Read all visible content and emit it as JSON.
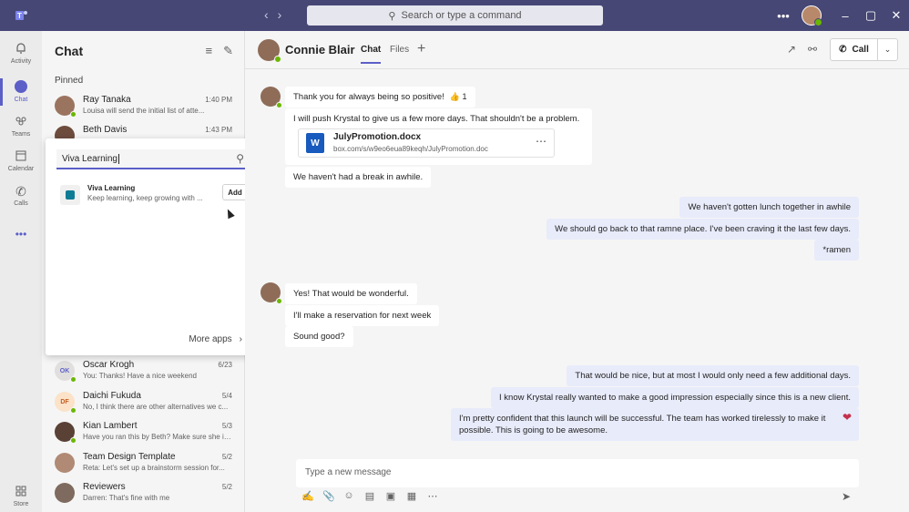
{
  "titlebar": {
    "search_placeholder": "Search or type a command",
    "more": "•••",
    "minimize": "–",
    "maximize": "▢",
    "close": "✕"
  },
  "rail": {
    "items": [
      {
        "label": "Activity",
        "icon": "bell-icon"
      },
      {
        "label": "Chat",
        "icon": "chat-icon"
      },
      {
        "label": "Teams",
        "icon": "teams-icon"
      },
      {
        "label": "Calendar",
        "icon": "calendar-icon"
      },
      {
        "label": "Calls",
        "icon": "phone-icon"
      },
      {
        "label": "Store",
        "icon": "store-icon"
      }
    ],
    "more": "•••"
  },
  "chatlist": {
    "title": "Chat",
    "pinned_label": "Pinned",
    "pinned": [
      {
        "name": "Ray Tanaka",
        "time": "1:40 PM",
        "preview": "Louisa will send the initial list of atte..."
      },
      {
        "name": "Beth Davis",
        "time": "1:43 PM",
        "preview": ""
      }
    ],
    "recent": [
      {
        "name": "Oscar Krogh",
        "time": "6/23",
        "preview": "You: Thanks! Have a nice weekend",
        "initials": "OK"
      },
      {
        "name": "Daichi Fukuda",
        "time": "5/4",
        "preview": "No, I think there are other alternatives we c...",
        "initials": "DF"
      },
      {
        "name": "Kian Lambert",
        "time": "5/3",
        "preview": "Have you ran this by Beth? Make sure she is..."
      },
      {
        "name": "Team Design Template",
        "time": "5/2",
        "preview": "Reta: Let's set up a brainstorm session for..."
      },
      {
        "name": "Reviewers",
        "time": "5/2",
        "preview": "Darren: That's fine with me"
      }
    ]
  },
  "flyout": {
    "search_value": "Viva Learning",
    "app": {
      "name": "Viva Learning",
      "description": "Keep learning, keep growing with ...",
      "add_label": "Add"
    },
    "more_apps": "More apps"
  },
  "conversation": {
    "name": "Connie Blair",
    "tabs": [
      "Chat",
      "Files"
    ],
    "call_label": "Call",
    "messages_in_1": [
      "Thank you for always being so positive!",
      "I will push Krystal to give us a few more days. That shouldn't be a problem.",
      "We haven't had a break in awhile."
    ],
    "reaction": "👍 1",
    "file": {
      "name": "JulyPromotion.docx",
      "path": "box.com/s/w9eo6eua89keqh/JulyPromotion.doc"
    },
    "messages_out_1": [
      "We haven't gotten lunch together in awhile",
      "We should go back to that ramne place. I've been craving it the last few days.",
      "*ramen"
    ],
    "messages_in_2": [
      "Yes! That would be wonderful.",
      "I'll make a reservation for next week",
      "Sound good?"
    ],
    "messages_out_2": [
      "That would be nice, but at most I would only need a few additional days.",
      "I know Krystal really wanted to make a good impression especially since this is a new client.",
      "I'm pretty confident that this launch will be successful. The team has worked tirelessly to make it possible. This is going to be awesome."
    ],
    "compose_placeholder": "Type a new message"
  }
}
